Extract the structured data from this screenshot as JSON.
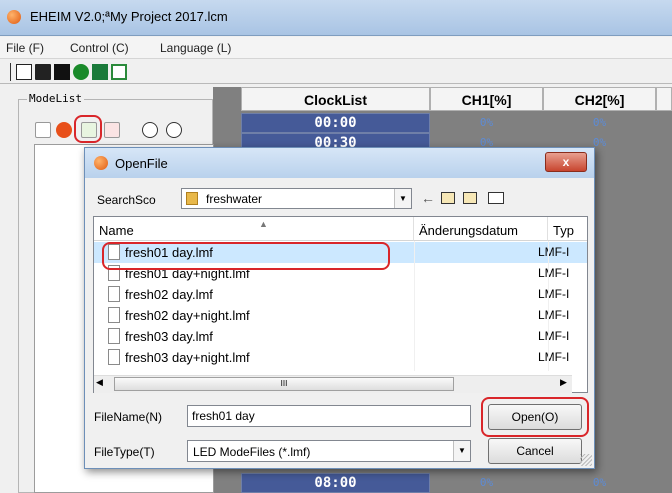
{
  "window": {
    "title": "EHEIM V2.0;ªMy Project 2017.lcm"
  },
  "menu": [
    {
      "label": "File (F)"
    },
    {
      "label": "Control (C)"
    },
    {
      "label": "Language (L)"
    }
  ],
  "toolbar": [
    "new-icon",
    "open-icon",
    "save-icon",
    "play-icon",
    "upload-icon",
    "clock-icon"
  ],
  "modelist": {
    "legend": "ModeList",
    "buttons": [
      "new-mode-icon",
      "delete-mode-icon",
      "import-mode-icon",
      "export-mode-icon",
      "move-up-icon",
      "move-down-icon"
    ]
  },
  "grid": {
    "headers": [
      "ClockList",
      "CH1[%]",
      "CH2[%]"
    ],
    "rows": [
      {
        "time": "00:00",
        "ch1": "0%",
        "ch2": "0%"
      },
      {
        "time": "00:30",
        "ch1": "0%",
        "ch2": "0%"
      },
      {
        "time": "08:00",
        "ch1": "0%",
        "ch2": "0%"
      }
    ]
  },
  "dialog": {
    "title": "OpenFile",
    "close_label": "x",
    "search_label": "SearchSco",
    "search_folder": "freshwater",
    "columns": [
      "Name",
      "Änderungsdatum",
      "Typ"
    ],
    "files": [
      {
        "name": "fresh01 day.lmf",
        "type": "LMF-I",
        "selected": true
      },
      {
        "name": "fresh01 day+night.lmf",
        "type": "LMF-I"
      },
      {
        "name": "fresh02 day.lmf",
        "type": "LMF-I"
      },
      {
        "name": "fresh02 day+night.lmf",
        "type": "LMF-I"
      },
      {
        "name": "fresh03 day.lmf",
        "type": "LMF-I"
      },
      {
        "name": "fresh03 day+night.lmf",
        "type": "LMF-I"
      }
    ],
    "filename_label": "FileName(N)",
    "filename_value": "fresh01 day",
    "filetype_label": "FileType(T)",
    "filetype_value": "LED ModeFiles (*.lmf)",
    "open_label": "Open(O)",
    "cancel_label": "Cancel",
    "scroll_thumb": "III"
  },
  "colors": {
    "highlight": "#d9262a",
    "accent": "#455a98"
  }
}
